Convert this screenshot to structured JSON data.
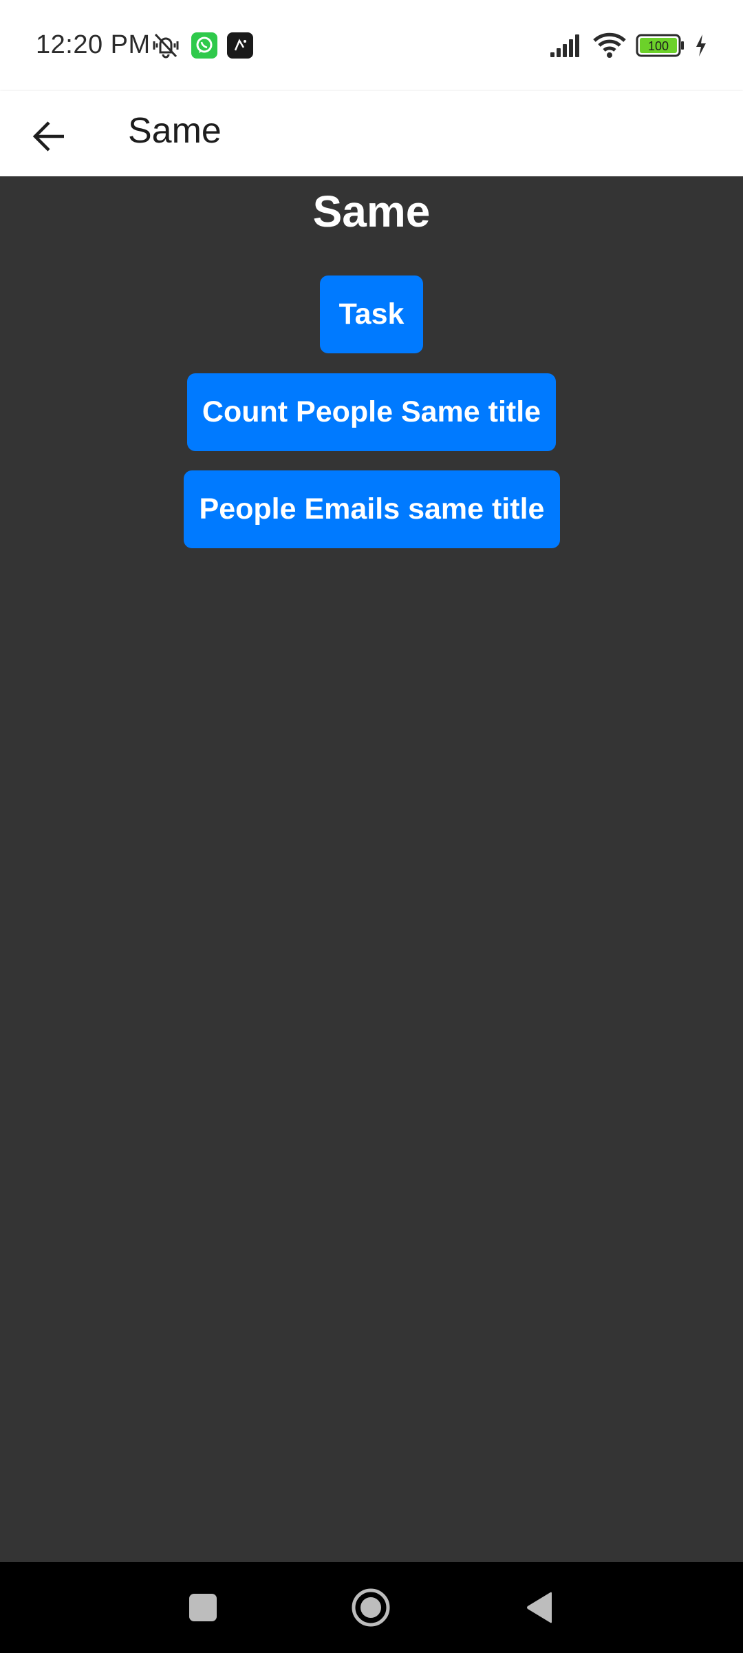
{
  "status_bar": {
    "time": "12:20 PM",
    "battery_level": "100",
    "icons": [
      "mute-icon",
      "whatsapp-icon",
      "app-notification-icon",
      "signal-icon",
      "wifi-icon",
      "battery-icon",
      "charging-icon"
    ]
  },
  "app_bar": {
    "title": "Same",
    "back_icon": "arrow-left-icon"
  },
  "main": {
    "heading": "Same",
    "buttons": [
      {
        "label": "Task"
      },
      {
        "label": "Count People Same title"
      },
      {
        "label": "People Emails same title"
      }
    ]
  },
  "nav_bar": {
    "icons": [
      "recents-square-icon",
      "home-circle-icon",
      "back-triangle-icon"
    ]
  },
  "colors": {
    "button_bg": "#007aff",
    "content_bg": "#343434",
    "app_bar_bg": "#ffffff",
    "battery_fill": "#6cd12a"
  }
}
